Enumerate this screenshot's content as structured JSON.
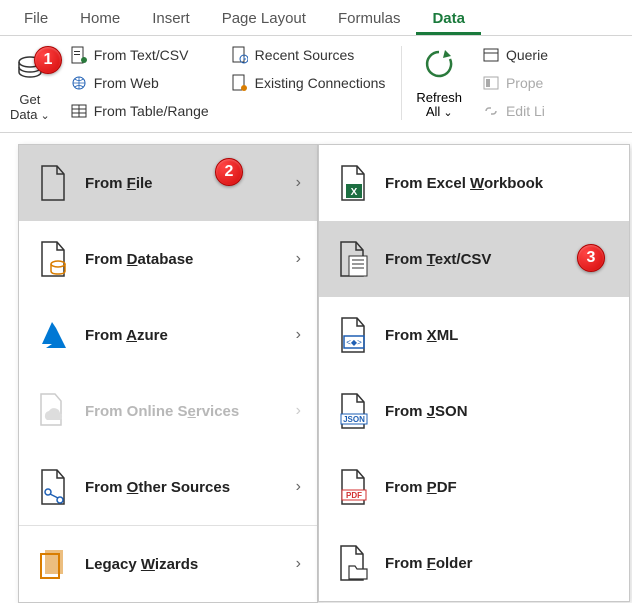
{
  "tabs": {
    "file": "File",
    "home": "Home",
    "insert": "Insert",
    "page_layout": "Page Layout",
    "formulas": "Formulas",
    "data": "Data"
  },
  "ribbon": {
    "get_data": "Get\nData",
    "from_text_csv": "From Text/CSV",
    "from_web": "From Web",
    "from_table_range": "From Table/Range",
    "recent_sources": "Recent Sources",
    "existing_connections": "Existing Connections",
    "refresh_all": "Refresh\nAll",
    "queries": "Querie",
    "properties": "Prope",
    "edit_links": "Edit Li"
  },
  "menu1": {
    "from_file": "From File",
    "from_database": "From Database",
    "from_azure": "From Azure",
    "from_online": "From Online Services",
    "from_other": "From Other Sources",
    "legacy": "Legacy Wizards"
  },
  "menu2": {
    "workbook": "From Excel Workbook",
    "textcsv": "From Text/CSV",
    "xml": "From XML",
    "json": "From JSON",
    "pdf": "From PDF",
    "folder": "From Folder"
  },
  "badges": {
    "b1": "1",
    "b2": "2",
    "b3": "3"
  }
}
